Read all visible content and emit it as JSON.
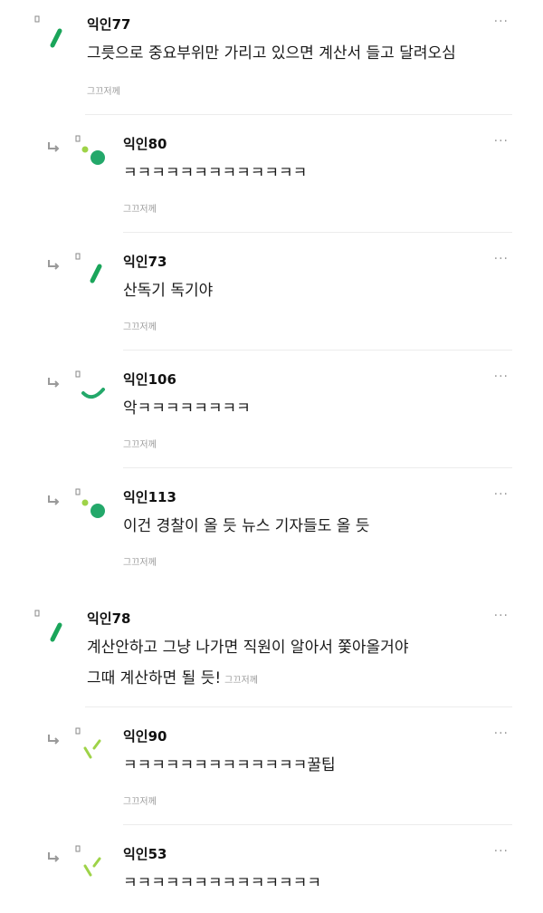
{
  "comments": [
    {
      "nick": "익인77",
      "text": "그릇으로 중요부위만 가리고 있으면 계산서 들고 달려오심",
      "meta": "그끄저께",
      "more": "···"
    },
    {
      "nick": "익인80",
      "text": "ㅋㅋㅋㅋㅋㅋㅋㅋㅋㅋㅋㅋㅋ",
      "meta": "그끄저께",
      "more": "···"
    },
    {
      "nick": "익인73",
      "text": "산독기 독기야",
      "meta": "그끄저께",
      "more": "···"
    },
    {
      "nick": "익인106",
      "text": "악ㅋㅋㅋㅋㅋㅋㅋㅋ",
      "meta": "그끄저께",
      "more": "···"
    },
    {
      "nick": "익인113",
      "text": "이건 경찰이 올 듯 뉴스 기자들도 올 듯",
      "meta": "그끄저께",
      "more": "···"
    },
    {
      "nick": "익인78",
      "text_line1": "계산안하고 그냥 나가면 직원이 알아서 쫓아올거야",
      "text_line2": "그때 계산하면 될 듯!",
      "meta": "그끄저께",
      "more": "···"
    },
    {
      "nick": "익인90",
      "text": "ㅋㅋㅋㅋㅋㅋㅋㅋㅋㅋㅋㅋㅋ꿀팁",
      "meta": "그끄저께",
      "more": "···"
    },
    {
      "nick": "익인53",
      "text": "ㅋㅋㅋㅋㅋㅋㅋㅋㅋㅋㅋㅋㅋㅋ",
      "more": "···"
    }
  ],
  "colors": {
    "dark_green": "#1aa55a",
    "light_green": "#9ed348",
    "teal": "#23a86a",
    "gray_text": "#9a9a9a"
  }
}
